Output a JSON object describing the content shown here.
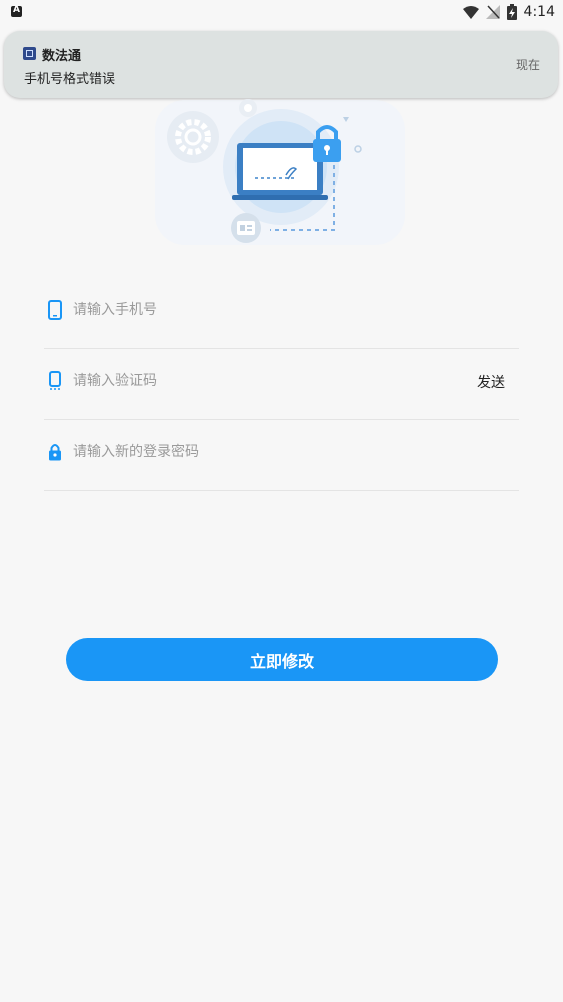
{
  "status_bar": {
    "time": "4:14",
    "icons": [
      "wifi-icon",
      "no-signal-icon",
      "battery-charging-icon"
    ]
  },
  "notification": {
    "app_name": "数法通",
    "message": "手机号格式错误",
    "time": "现在",
    "app_icon": "app-logo-icon"
  },
  "form": {
    "phone": {
      "placeholder": "请输入手机号",
      "value": "",
      "icon": "phone-icon"
    },
    "code": {
      "placeholder": "请输入验证码",
      "value": "",
      "icon": "sms-phone-icon",
      "send_label": "发送"
    },
    "password": {
      "placeholder": "请输入新的登录密码",
      "value": "",
      "icon": "lock-icon"
    }
  },
  "submit": {
    "label": "立即修改"
  },
  "colors": {
    "accent": "#1a96f6",
    "background": "#f7f7f7",
    "notification_bg": "#dde2e1"
  }
}
